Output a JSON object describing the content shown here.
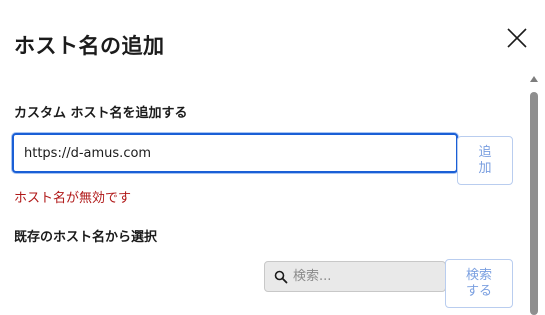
{
  "dialog": {
    "title": "ホスト名の追加",
    "custom_host_label": "カスタム ホスト名を追加する",
    "host_input_value": "https://d-amus.com",
    "add_button_label": "追\n加",
    "error_message": "ホスト名が無効です",
    "existing_host_label": "既存のホスト名から選択",
    "search_placeholder": "検索...",
    "search_button_label": "検索\nする"
  },
  "icons": {
    "close": "close-icon",
    "search": "search-icon",
    "scroll_up": "chevron-up-icon"
  },
  "colors": {
    "focus_border": "#1a5fd6",
    "error_text": "#b01818",
    "button_text": "#7a9fe0",
    "search_background": "#e9e9e9"
  }
}
